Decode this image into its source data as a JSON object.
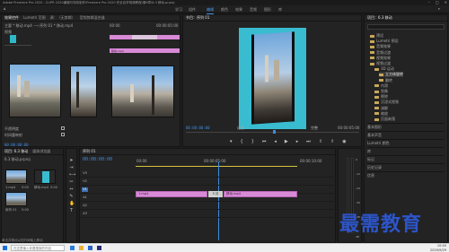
{
  "titlebar": {
    "title": "Adobe Premiere Pro 2020 - D:\\PR 2020编辑与特效制作\\Premiere Pro 2020 完全自学视频教程\\第6章\\6.3 移动.prproj"
  },
  "workspaces": {
    "items": [
      "学习",
      "组件",
      "编辑",
      "颜色",
      "效果",
      "音频",
      "图形",
      "库"
    ],
    "active": "编辑"
  },
  "source": {
    "tabs": [
      "效果控件",
      "Lumetri 范围",
      "源：（无剪辑）",
      "音频剪辑混合器"
    ],
    "header": "主要 * 移动.mp4 ⟶ 序列 01 * 移动.mp4",
    "clip_label": "视频",
    "fx_clip_label": "移动.mp4",
    "tc_start": "00:00",
    "tc_end": "00:00:05:00",
    "props": [
      "不透明度",
      "时间重映射"
    ],
    "opacity_value": "100.0 %",
    "timecode": "00:00:00:00"
  },
  "program": {
    "tab": "节目：序列 01",
    "tc_left": "00:00:00:00",
    "fit": "适合",
    "quality": "完整",
    "tc_right": "00:00:05:00"
  },
  "project": {
    "tab": "项目：6.3 移动",
    "search_placeholder": "",
    "tree": [
      {
        "label": "预设",
        "indent": 0
      },
      {
        "label": "Lumetri 预设",
        "indent": 0
      },
      {
        "label": "音频效果",
        "indent": 0
      },
      {
        "label": "音频过渡",
        "indent": 0
      },
      {
        "label": "视频效果",
        "indent": 0
      },
      {
        "label": "视频过渡",
        "indent": 0
      },
      {
        "label": "3D 运动",
        "indent": 1
      },
      {
        "label": "立方体旋转",
        "indent": 2
      },
      {
        "label": "翻转",
        "indent": 2
      },
      {
        "label": "内滑",
        "indent": 1
      },
      {
        "label": "划像",
        "indent": 1
      },
      {
        "label": "擦除",
        "indent": 1
      },
      {
        "label": "沉浸式视频",
        "indent": 1
      },
      {
        "label": "溶解",
        "indent": 1
      },
      {
        "label": "缩放",
        "indent": 1
      },
      {
        "label": "页面剥落",
        "indent": 1
      }
    ],
    "panels": [
      "基本图形",
      "基本声音",
      "Lumetri 颜色",
      "库",
      "标记",
      "历史记录",
      "信息"
    ]
  },
  "bin": {
    "tabs": [
      "项目: 6.3 移动",
      "媒体浏览器"
    ],
    "path": "6.3 移动.prproj",
    "items": [
      {
        "name": "1.mp4",
        "dur": "5:00"
      },
      {
        "name": "移动.mp4",
        "dur": "5:00"
      },
      {
        "name": "序列 01",
        "dur": "5:00"
      }
    ]
  },
  "timeline": {
    "tab": "序列 01",
    "timecode": "00:00:00:00",
    "ruler": [
      "00:00",
      "00:00:05:00",
      "00:00:10:00"
    ],
    "tracks": [
      "V3",
      "V2",
      "V1",
      "A1",
      "A2",
      "A3"
    ],
    "clip_v1": "1.mp4",
    "clip_v1b": "移动.mp4",
    "clip_tooltip": "5 月"
  },
  "meters": {
    "labels": [
      "0",
      "-12",
      "-24",
      "-36",
      "-48",
      "dB"
    ]
  },
  "taskbar": {
    "search": "在这里输入你要搜索的内容",
    "clock": "10:40",
    "date": "2020/9/29"
  },
  "status": "单击并拖动以在时间轴上移动",
  "watermark": "最需教育"
}
